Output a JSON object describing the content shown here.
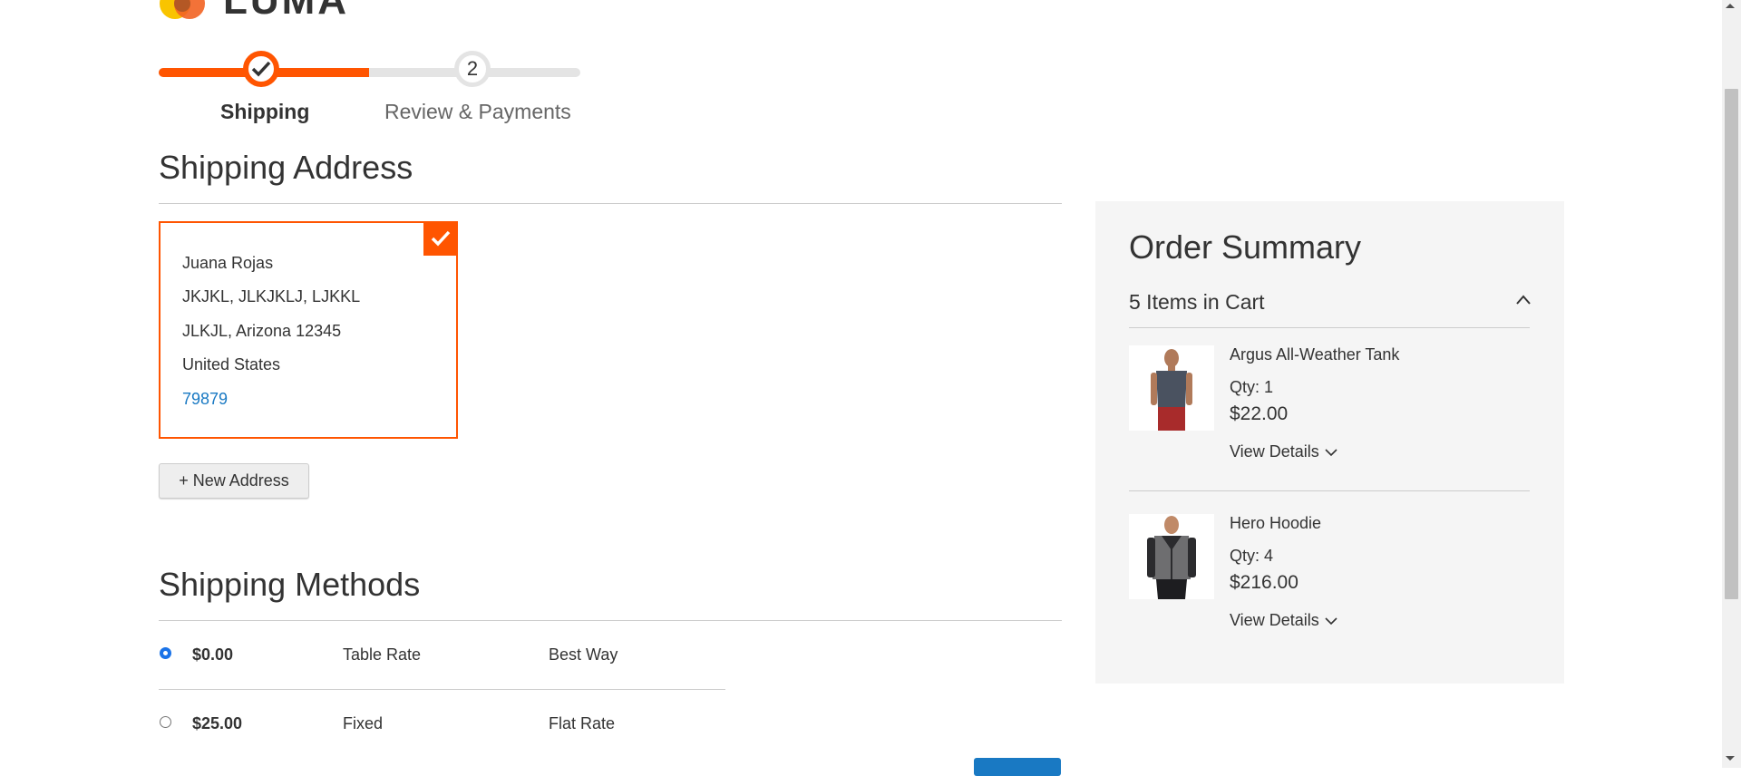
{
  "header": {
    "logo_text": "LUMA"
  },
  "progress": {
    "steps": [
      {
        "number": "",
        "label": "Shipping",
        "state": "complete"
      },
      {
        "number": "2",
        "label": "Review & Payments",
        "state": "pending"
      }
    ],
    "accent_color": "#ff5501"
  },
  "shipping_address": {
    "title": "Shipping Address",
    "selected_card": {
      "name": "Juana Rojas",
      "street": "JKJKL, JLKJKLJ, LJKKL",
      "city_region": "JLKJL, Arizona 12345",
      "country": "United States",
      "phone": "79879"
    },
    "new_address_label": "+ New Address"
  },
  "shipping_methods": {
    "title": "Shipping Methods",
    "rows": [
      {
        "price": "$0.00",
        "carrier": "Table Rate",
        "method": "Best Way",
        "selected": true
      },
      {
        "price": "$25.00",
        "carrier": "Fixed",
        "method": "Flat Rate",
        "selected": false
      }
    ]
  },
  "order_summary": {
    "title": "Order Summary",
    "items_in_cart": "5 Items in Cart",
    "items": [
      {
        "name": "Argus All-Weather Tank",
        "qty": "Qty: 1",
        "price": "$22.00",
        "details_label": "View Details"
      },
      {
        "name": "Hero Hoodie",
        "qty": "Qty: 4",
        "price": "$216.00",
        "details_label": "View Details"
      }
    ]
  },
  "colors": {
    "brand_orange": "#ff5501",
    "link_blue": "#1979c3",
    "summary_bg": "#f5f5f5"
  }
}
